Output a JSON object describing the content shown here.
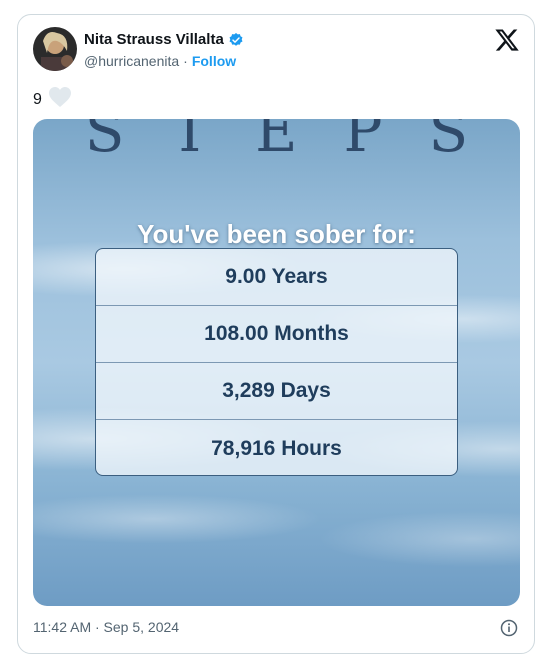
{
  "author": {
    "name": "Nita Strauss Villalta",
    "handle": "@hurricanenita",
    "separator": "·",
    "follow_label": "Follow"
  },
  "likes": {
    "count": "9"
  },
  "media": {
    "title": "STEPS",
    "heading": "You've been sober for:",
    "stats": [
      "9.00 Years",
      "108.00 Months",
      "3,289 Days",
      "78,916 Hours"
    ]
  },
  "footer": {
    "timestamp": "11:42 AM · Sep 5, 2024"
  },
  "colors": {
    "accent": "#1d9bf0",
    "text": "#0f1419",
    "muted": "#536471",
    "stat_text": "#1f3d5c"
  }
}
